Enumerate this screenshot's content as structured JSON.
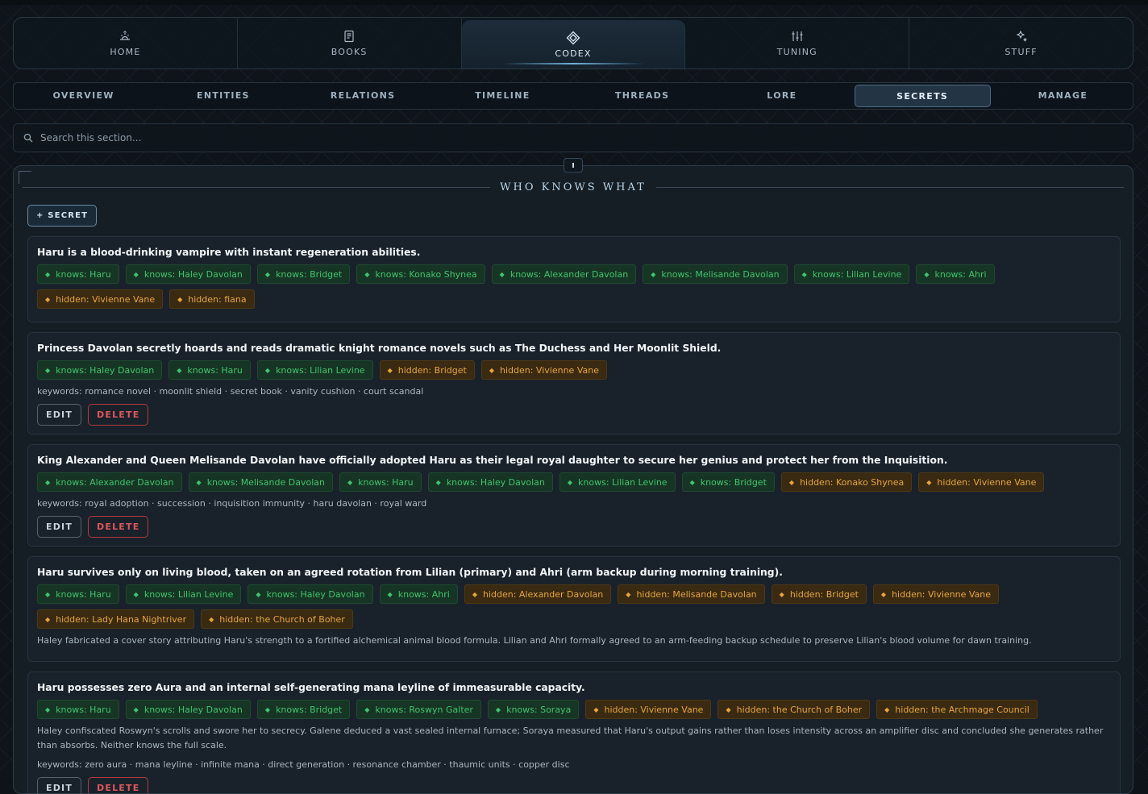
{
  "main_nav": [
    {
      "label": "HOME",
      "icon": "sunrise-icon"
    },
    {
      "label": "BOOKS",
      "icon": "book-icon"
    },
    {
      "label": "CODEX",
      "icon": "diamond-icon",
      "active": true
    },
    {
      "label": "TUNING",
      "icon": "sliders-icon"
    },
    {
      "label": "STUFF",
      "icon": "sparkle-icon"
    }
  ],
  "sub_nav": [
    {
      "label": "OVERVIEW"
    },
    {
      "label": "ENTITIES"
    },
    {
      "label": "RELATIONS"
    },
    {
      "label": "TIMELINE"
    },
    {
      "label": "THREADS"
    },
    {
      "label": "LORE"
    },
    {
      "label": "SECRETS",
      "active": true
    },
    {
      "label": "MANAGE"
    }
  ],
  "search": {
    "placeholder": "Search this section..."
  },
  "panel": {
    "title": "WHO KNOWS WHAT",
    "add_label": "+ SECRET",
    "edit_label": "EDIT",
    "delete_label": "DELETE"
  },
  "colors": {
    "knows": "#3fc36f",
    "hidden": "#e8a53b",
    "delete": "#e0565d",
    "accent": "#6fb3d8"
  },
  "secrets": [
    {
      "title": "Haru is a blood-drinking vampire with instant regeneration abilities.",
      "tags": [
        {
          "kind": "knows",
          "text": "knows: Haru"
        },
        {
          "kind": "knows",
          "text": "knows: Haley Davolan"
        },
        {
          "kind": "knows",
          "text": "knows: Bridget"
        },
        {
          "kind": "knows",
          "text": "knows: Konako Shynea"
        },
        {
          "kind": "knows",
          "text": "knows: Alexander Davolan"
        },
        {
          "kind": "knows",
          "text": "knows: Melisande Davolan"
        },
        {
          "kind": "knows",
          "text": "knows: Lilian Levine"
        },
        {
          "kind": "knows",
          "text": "knows: Ahri"
        },
        {
          "kind": "hidden",
          "text": "hidden: Vivienne Vane"
        },
        {
          "kind": "hidden",
          "text": "hidden: fiana"
        }
      ],
      "note": "",
      "keywords": "",
      "actions": false
    },
    {
      "title": "Princess Davolan secretly hoards and reads dramatic knight romance novels such as The Duchess and Her Moonlit Shield.",
      "tags": [
        {
          "kind": "knows",
          "text": "knows: Haley Davolan"
        },
        {
          "kind": "knows",
          "text": "knows: Haru"
        },
        {
          "kind": "knows",
          "text": "knows: Lilian Levine"
        },
        {
          "kind": "hidden",
          "text": "hidden: Bridget"
        },
        {
          "kind": "hidden",
          "text": "hidden: Vivienne Vane"
        }
      ],
      "note": "",
      "keywords": "keywords: romance novel · moonlit shield · secret book · vanity cushion · court scandal",
      "actions": true
    },
    {
      "title": "King Alexander and Queen Melisande Davolan have officially adopted Haru as their legal royal daughter to secure her genius and protect her from the Inquisition.",
      "tags": [
        {
          "kind": "knows",
          "text": "knows: Alexander Davolan"
        },
        {
          "kind": "knows",
          "text": "knows: Melisande Davolan"
        },
        {
          "kind": "knows",
          "text": "knows: Haru"
        },
        {
          "kind": "knows",
          "text": "knows: Haley Davolan"
        },
        {
          "kind": "knows",
          "text": "knows: Lilian Levine"
        },
        {
          "kind": "knows",
          "text": "knows: Bridget"
        },
        {
          "kind": "hidden",
          "text": "hidden: Konako Shynea"
        },
        {
          "kind": "hidden",
          "text": "hidden: Vivienne Vane"
        }
      ],
      "note": "",
      "keywords": "keywords: royal adoption · succession · inquisition immunity · haru davolan · royal ward",
      "actions": true
    },
    {
      "title": "Haru survives only on living blood, taken on an agreed rotation from Lilian (primary) and Ahri (arm backup during morning training).",
      "tags": [
        {
          "kind": "knows",
          "text": "knows: Haru"
        },
        {
          "kind": "knows",
          "text": "knows: Lilian Levine"
        },
        {
          "kind": "knows",
          "text": "knows: Haley Davolan"
        },
        {
          "kind": "knows",
          "text": "knows: Ahri"
        },
        {
          "kind": "hidden",
          "text": "hidden: Alexander Davolan"
        },
        {
          "kind": "hidden",
          "text": "hidden: Melisande Davolan"
        },
        {
          "kind": "hidden",
          "text": "hidden: Bridget"
        },
        {
          "kind": "hidden",
          "text": "hidden: Vivienne Vane"
        },
        {
          "kind": "hidden",
          "text": "hidden: Lady Hana Nightriver"
        },
        {
          "kind": "hidden",
          "text": "hidden: the Church of Boher"
        }
      ],
      "note": "Haley fabricated a cover story attributing Haru's strength to a fortified alchemical animal blood formula. Lilian and Ahri formally agreed to an arm-feeding backup schedule to preserve Lilian's blood volume for dawn training.",
      "keywords": "",
      "actions": false
    },
    {
      "title": "Haru possesses zero Aura and an internal self-generating mana leyline of immeasurable capacity.",
      "tags": [
        {
          "kind": "knows",
          "text": "knows: Haru"
        },
        {
          "kind": "knows",
          "text": "knows: Haley Davolan"
        },
        {
          "kind": "knows",
          "text": "knows: Bridget"
        },
        {
          "kind": "knows",
          "text": "knows: Roswyn Galter"
        },
        {
          "kind": "knows",
          "text": "knows: Soraya"
        },
        {
          "kind": "hidden",
          "text": "hidden: Vivienne Vane"
        },
        {
          "kind": "hidden",
          "text": "hidden: the Church of Boher"
        },
        {
          "kind": "hidden",
          "text": "hidden: the Archmage Council"
        }
      ],
      "note": "Haley confiscated Roswyn's scrolls and swore her to secrecy. Galene deduced a vast sealed internal furnace; Soraya measured that Haru's output gains rather than loses intensity across an amplifier disc and concluded she generates rather than absorbs. Neither knows the full scale.",
      "keywords": "keywords: zero aura · mana leyline · infinite mana · direct generation · resonance chamber · thaumic units · copper disc",
      "actions": true
    }
  ]
}
